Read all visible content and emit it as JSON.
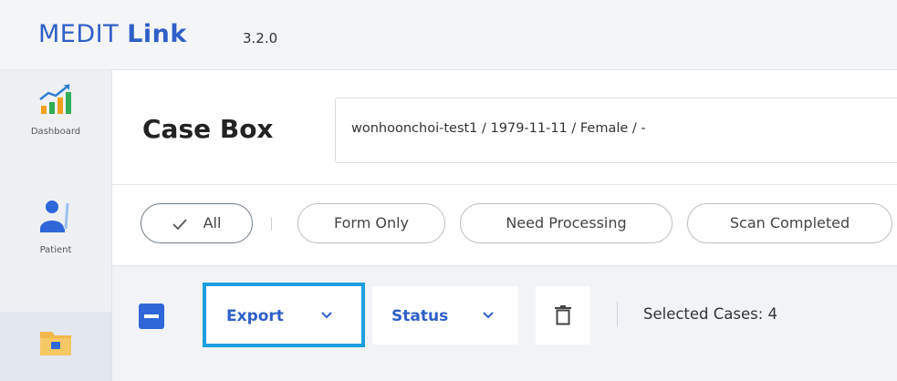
{
  "app": {
    "brand_prefix": "MEDIT",
    "brand_suffix": "Link",
    "version": "3.2.0"
  },
  "sidebar": {
    "items": [
      {
        "label": "Dashboard",
        "icon": "dashboard-chart-icon"
      },
      {
        "label": "Patient",
        "icon": "patient-icon"
      },
      {
        "label": "",
        "icon": "case-box-folder-icon"
      }
    ]
  },
  "header": {
    "title": "Case Box",
    "patient_info": "wonhoonchoi-test1 / 1979-11-11 / Female / -"
  },
  "filters": {
    "items": [
      {
        "label": "All",
        "selected": true
      },
      {
        "label": "Form Only"
      },
      {
        "label": "Need Processing"
      },
      {
        "label": "Scan Completed"
      }
    ]
  },
  "toolbar": {
    "export_label": "Export",
    "status_label": "Status",
    "selected_cases": "Selected Cases: 4"
  },
  "colors": {
    "brand": "#2f5fc7",
    "highlight": "#1c9fe0",
    "checkbox": "#2f67d9"
  }
}
